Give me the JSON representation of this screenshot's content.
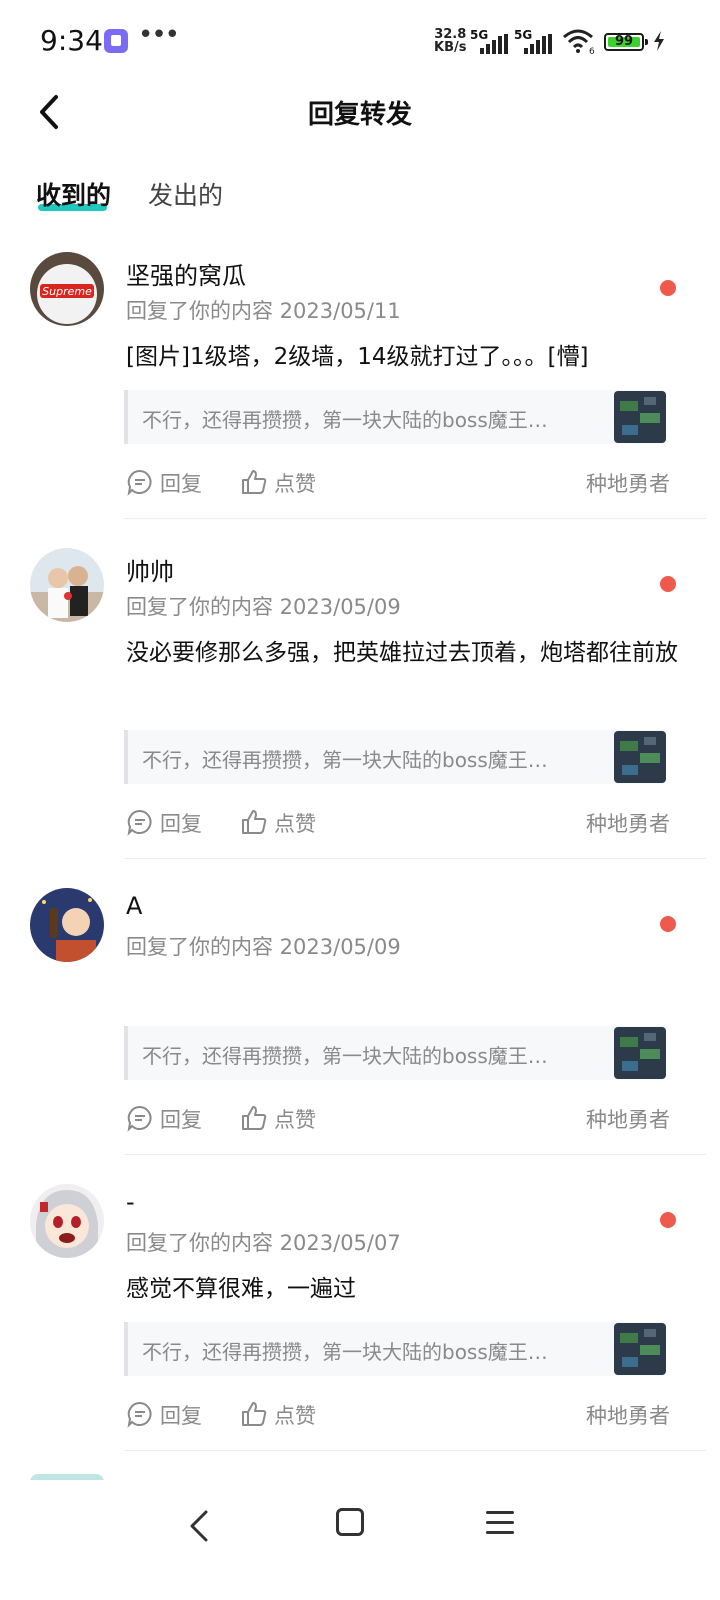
{
  "status_bar": {
    "time": "9:34",
    "net_speed_value": "32.8",
    "net_speed_unit": "KB/s",
    "sim1": "5G",
    "sim2": "5G",
    "wifi_badge": "6",
    "battery": "99"
  },
  "header": {
    "title": "回复转发"
  },
  "tabs": [
    {
      "label": "收到的",
      "active": true
    },
    {
      "label": "发出的",
      "active": false
    }
  ],
  "messages": [
    {
      "user": "坚强的窝瓜",
      "meta": "回复了你的内容 2023/05/11",
      "text": "[图片]1级塔，2级墙，14级就打过了。。。[懵]",
      "quote": "不行，还得再攒攒，第一块大陆的boss魔王…",
      "reply_label": "回复",
      "like_label": "点赞",
      "author": "种地勇者",
      "unread": true
    },
    {
      "user": "帅帅",
      "meta": "回复了你的内容 2023/05/09",
      "text": "没必要修那么多强，把英雄拉过去顶着，炮塔都往前放",
      "quote": "不行，还得再攒攒，第一块大陆的boss魔王…",
      "reply_label": "回复",
      "like_label": "点赞",
      "author": "种地勇者",
      "unread": true
    },
    {
      "user": "A",
      "meta": "回复了你的内容 2023/05/09",
      "text": "",
      "quote": "不行，还得再攒攒，第一块大陆的boss魔王…",
      "reply_label": "回复",
      "like_label": "点赞",
      "author": "种地勇者",
      "unread": true
    },
    {
      "user": "-",
      "meta": "回复了你的内容 2023/05/07",
      "text": "感觉不算很难，一遍过",
      "quote": "不行，还得再攒攒，第一块大陆的boss魔王…",
      "reply_label": "回复",
      "like_label": "点赞",
      "author": "种地勇者",
      "unread": true
    }
  ],
  "colors": {
    "tab_indicator": "#20c8c0",
    "unread_dot": "#f05a4e",
    "battery_fill": "#3bd22f",
    "secondary_text": "#8a8a8a"
  }
}
